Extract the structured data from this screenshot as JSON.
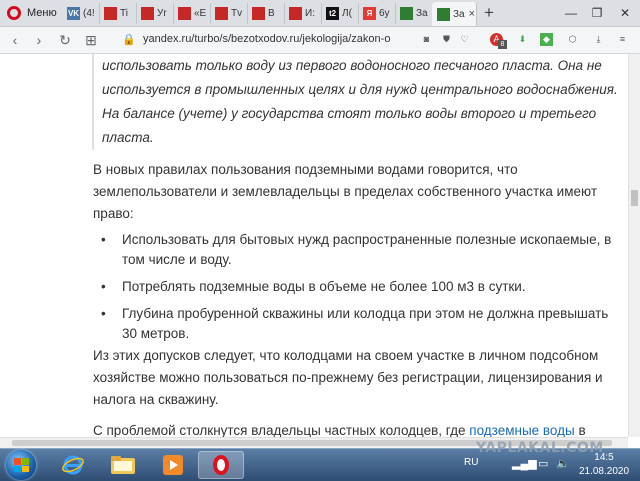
{
  "browser": {
    "menu_label": "Меню",
    "tabs": [
      {
        "fav_text": "VK",
        "fav_color": "#4a76a8",
        "label": "(4!"
      },
      {
        "fav_text": "",
        "fav_color": "#c62828",
        "label": "Ti"
      },
      {
        "fav_text": "",
        "fav_color": "#c62828",
        "label": "Уr"
      },
      {
        "fav_text": "",
        "fav_color": "#c62828",
        "label": "«E"
      },
      {
        "fav_text": "",
        "fav_color": "#c62828",
        "label": "Tv"
      },
      {
        "fav_text": "",
        "fav_color": "#c62828",
        "label": "B"
      },
      {
        "fav_text": "",
        "fav_color": "#c62828",
        "label": "И:"
      },
      {
        "fav_text": "t2",
        "fav_color": "#111111",
        "label": "Л("
      },
      {
        "fav_text": "Я",
        "fav_color": "#e53935",
        "label": "6y"
      },
      {
        "fav_text": "",
        "fav_color": "#2e7d32",
        "label": "За"
      },
      {
        "fav_text": "",
        "fav_color": "#2e7d32",
        "label": "За",
        "active": true
      }
    ],
    "url": "yandex.ru/turbo/s/bezotxodov.ru/jekologija/zakon-o",
    "abp_count": "8"
  },
  "article": {
    "quote": "использовать только воду из первого водоносного песчаного пласта. Она не используется в промышленных целях и для нужд центрального водоснабжения. На балансе (учете) у государства стоят только воды второго и третьего пласта.",
    "para1": "В новых правилах пользования подземными водами говорится, что землепользователи и землевладельцы в пределах собственного участка имеют право:",
    "list": [
      "Использовать для бытовых нужд распространенные полезные ископаемые, в том числе и воду.",
      "Потреблять подземные воды в объеме не более 100 м3 в сутки.",
      "Глубина пробуренной скважины или колодца при этом не должна превышать 30 метров."
    ],
    "para2": "Из этих допусков следует, что колодцами на своем участке в личном подсобном хозяйстве можно пользоваться по-прежнему без регистрации, лицензирования и налога на скважину.",
    "para3_start": "С проблемой столкнутся владельцы частных колодцев, где ",
    "para3_link": "подземные воды",
    "para3_end": " в"
  },
  "taskbar": {
    "lang": "RU",
    "time": "14:5",
    "date": "21.08.2020"
  },
  "watermark": "YAPLAKAL.COM"
}
